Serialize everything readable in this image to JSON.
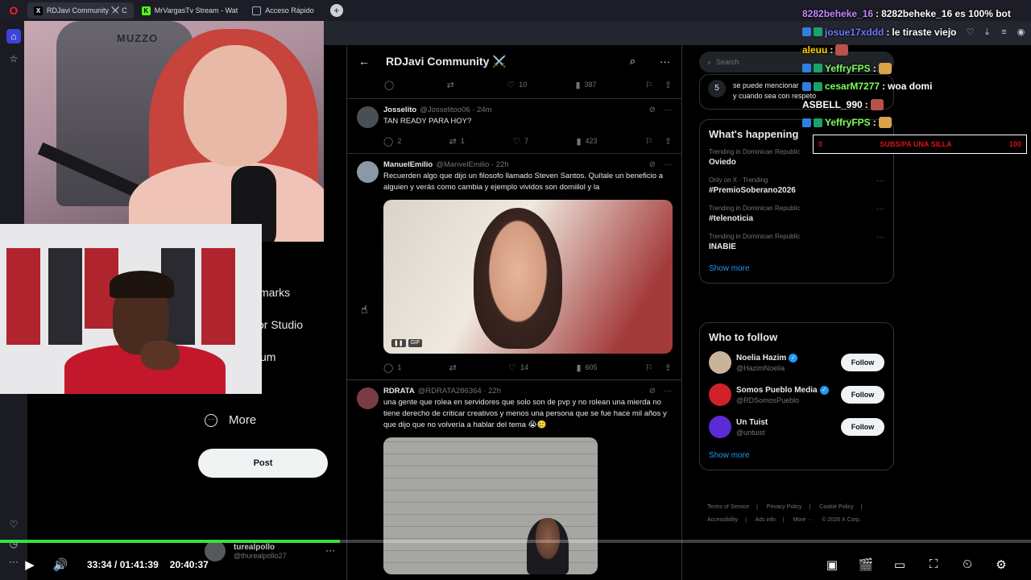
{
  "browser": {
    "tabs": [
      {
        "label": "RDJavi Community ⚔️ C",
        "favicon": "X"
      },
      {
        "label": "MrVargasTv Stream - Wat",
        "favicon": "K"
      },
      {
        "label": "Acceso Rápido",
        "favicon": ""
      }
    ]
  },
  "main": {
    "title": "RDJavi Community ⚔️",
    "top_actions": {
      "replies": "",
      "reposts": "",
      "likes": "10",
      "views": "387"
    },
    "tweets": [
      {
        "name": "Josselito",
        "handle": "@Josselitoo06 · 24m",
        "text": "TAN READY PARA HOY?",
        "replies": "2",
        "reposts": "1",
        "likes": "7",
        "views": "423"
      },
      {
        "name": "ManuelEmilio",
        "handle": "@ManvelEmilio · 22h",
        "text": "Recuerden algo que dijo un filosofo llamado Steven Santos. Quítale un beneficio a alguien y verás como cambia y ejemplo vividos son domiilol y la",
        "gif_pause": "❚❚",
        "gif_label": "GIF",
        "replies": "1",
        "reposts": "",
        "likes": "14",
        "views": "605"
      },
      {
        "name": "RDRATA",
        "handle": "@RDRATA286364 · 22h",
        "text": "una gente que rolea en servidores que solo son de pvp y no rolean una mierda no tiene derecho de criticar creativos y menos una persona que se fue hace mil años y que dijo que no volvería a hablar del tema 😭🥲"
      }
    ]
  },
  "left": {
    "nav_partial": [
      "marks",
      "or Studio",
      "um"
    ],
    "more_label": "More",
    "post_label": "Post",
    "user_name": "turealpollo",
    "user_handle": "@thurealpollo27"
  },
  "right": {
    "search_placeholder": "Search",
    "partial_num": "5",
    "partial_text_1": "se puede mencionar",
    "partial_text_2": "y cuando sea con respeto",
    "happening_title": "What's happening",
    "trends": [
      {
        "sub": "Trending in Dominican Republic",
        "main": "Oviedo"
      },
      {
        "sub": "Only on X · Trending",
        "main": "#PremioSoberano2026"
      },
      {
        "sub": "Trending in Dominican Republic",
        "main": "#telenoticia"
      },
      {
        "sub": "Trending in Dominican Republic",
        "main": "INABIE"
      }
    ],
    "show_more": "Show more",
    "follow_title": "Who to follow",
    "follow": [
      {
        "name": "Noelia Hazim",
        "handle": "@HazimNoelia",
        "verified": true,
        "color": "#c9b39a"
      },
      {
        "name": "Somos Pueblo Media",
        "handle": "@RDSomosPueblo",
        "verified": true,
        "color": "#d0202a"
      },
      {
        "name": "Un Tuist",
        "handle": "@untuist",
        "verified": false,
        "color": "#5b2bd6"
      }
    ],
    "follow_label": "Follow",
    "show_more_2": "Show more",
    "footer": [
      "Terms of Service",
      "|",
      "Privacy Policy",
      "|",
      "Cookie Policy",
      "|",
      "Accessibility",
      "|",
      "Ads info",
      "|",
      "More ···",
      "© 2026 X Corp."
    ]
  },
  "cams": {
    "chair_logo": "MUZZO"
  },
  "chat": [
    {
      "user": "8282beheke_16",
      "msg": "8282beheke_16 es 100% bot",
      "color": "#c089ff",
      "badges": false
    },
    {
      "user": "josue17xddd",
      "msg": "le tiraste viejo",
      "color": "#6b7cff",
      "badges": true
    },
    {
      "user": "aleuu",
      "msg": "",
      "color": "#ffd400",
      "badges": false
    },
    {
      "user": "YeffryFPS",
      "msg": "",
      "color": "#7cff5c",
      "badges": true
    },
    {
      "user": "cesarM7277",
      "msg": "woa domi",
      "color": "#7cff5c",
      "badges": true
    },
    {
      "user": "ASBELL_990",
      "msg": "",
      "color": "#ffffff",
      "badges": false
    },
    {
      "user": "YeffryFPS",
      "msg": "",
      "color": "#7cff5c",
      "badges": true
    }
  ],
  "goal": {
    "left": "0",
    "center": "SUBS/PA UNA SILLA",
    "right": "100"
  },
  "player": {
    "current": "33:34",
    "separator": "/",
    "duration": "01:41:39",
    "clock": "20:40:37",
    "progress": 0.33
  },
  "colors": {
    "x_blue": "#1d9bf0",
    "progress": "#37e03f",
    "goal_red": "#e01010"
  }
}
